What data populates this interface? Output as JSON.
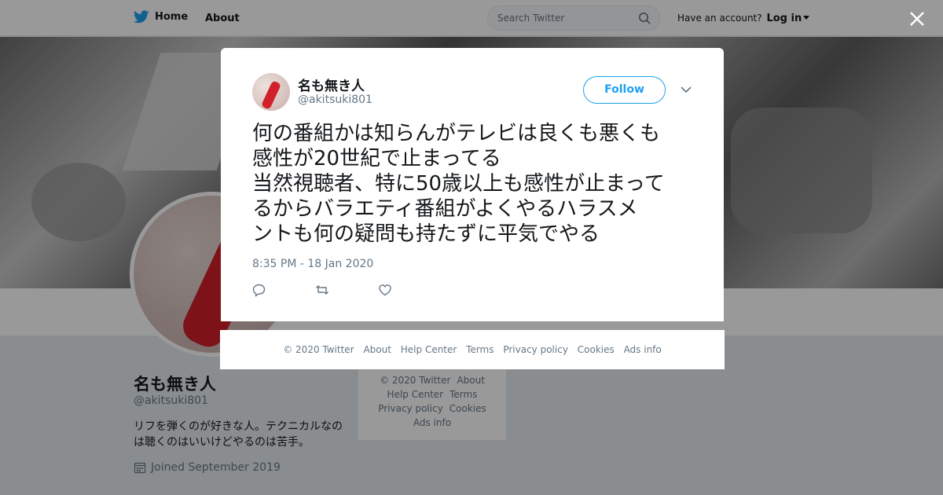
{
  "topbar": {
    "home_label": "Home",
    "about_label": "About",
    "search_placeholder": "Search Twitter",
    "account_prompt": "Have an account?",
    "login_label": "Log in"
  },
  "profile": {
    "name": "名も無き人",
    "handle": "@akitsuki801",
    "bio": "リフを弾くのが好きな人。テクニカルなのは聴くのはいいけどやるのは苦手。",
    "joined": "Joined September 2019"
  },
  "side_footer": {
    "line1": [
      "© 2020 Twitter",
      "About"
    ],
    "line2": [
      "Help Center",
      "Terms"
    ],
    "line3": [
      "Privacy policy",
      "Cookies"
    ],
    "line4": [
      "Ads info"
    ]
  },
  "tweet": {
    "author_name": "名も無き人",
    "author_handle": "@akitsuki801",
    "follow_label": "Follow",
    "lines": [
      "何の番組かは知らんがテレビは良くも悪くも",
      "感性が20世紀で止まってる",
      "当然視聴者、特に50歳以上も感性が止まって",
      "るからバラエティ番組がよくやるハラスメ",
      "ントも何の疑問も持たずに平気でやる"
    ],
    "timestamp": "8:35 PM - 18 Jan 2020"
  },
  "modal_footer": [
    "© 2020 Twitter",
    "About",
    "Help Center",
    "Terms",
    "Privacy policy",
    "Cookies",
    "Ads info"
  ],
  "colors": {
    "accent": "#1da1f2",
    "secondary_text": "#657786"
  },
  "icons": [
    "twitter-bird-icon",
    "search-icon",
    "close-icon",
    "chevron-down-icon",
    "reply-icon",
    "retweet-icon",
    "like-icon",
    "calendar-icon"
  ]
}
